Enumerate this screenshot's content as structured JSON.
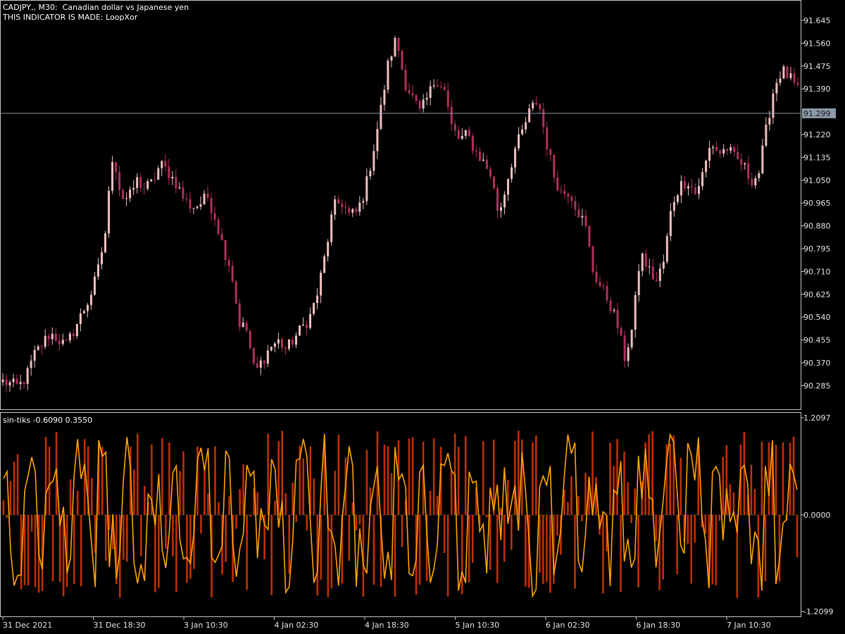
{
  "header": {
    "symbol_line": "CADJPY,, M30:  Canadian dollar vs Japanese yen",
    "indicator_line": "THIS INDICATOR IS MADE: LoopXor"
  },
  "subwindow": {
    "title": "sin-tiks -0.6090 0.3550"
  },
  "colors": {
    "background": "#000000",
    "axis": "#c8c8c8",
    "candle_bull": "#f0c0c0",
    "candle_bear": "#b03060",
    "histogram": "#c03000",
    "osc_line": "#ffa500",
    "price_line": "#8a9aa8",
    "price_tag": "#8a9aa8"
  },
  "chart_data": [
    {
      "type": "candlestick",
      "title": "CADJPY,, M30:  Canadian dollar vs Japanese yen",
      "y_ticks": [
        "91.645",
        "91.560",
        "91.475",
        "91.390",
        "91.220",
        "91.135",
        "91.050",
        "90.965",
        "90.880",
        "90.795",
        "90.710",
        "90.625",
        "90.540",
        "90.455",
        "90.370",
        "90.285"
      ],
      "ylim": [
        90.21,
        91.7
      ],
      "current_price": "91.299",
      "x_ticks": [
        "31 Dec 2021",
        "31 Dec 18:30",
        "3 Jan 10:30",
        "4 Jan 02:30",
        "4 Jan 18:30",
        "5 Jan 10:30",
        "6 Jan 02:30",
        "6 Jan 18:30",
        "7 Jan 10:30"
      ],
      "close_anchors": [
        90.3,
        90.29,
        90.28,
        90.32,
        90.4,
        90.44,
        90.48,
        90.46,
        90.43,
        90.49,
        90.55,
        90.61,
        90.7,
        90.85,
        91.16,
        90.99,
        90.98,
        91.05,
        91.02,
        91.04,
        91.11,
        91.08,
        91.04,
        90.98,
        90.95,
        90.96,
        90.99,
        90.91,
        90.8,
        90.72,
        90.52,
        90.49,
        90.33,
        90.38,
        90.43,
        90.45,
        90.42,
        90.46,
        90.5,
        90.54,
        90.63,
        90.78,
        90.95,
        90.97,
        90.92,
        90.93,
        91.01,
        91.15,
        91.31,
        91.49,
        91.58,
        91.42,
        91.36,
        91.3,
        91.36,
        91.43,
        91.4,
        91.25,
        91.2,
        91.22,
        91.16,
        91.12,
        91.07,
        90.92,
        91.04,
        91.16,
        91.23,
        91.31,
        91.35,
        91.2,
        91.07,
        91.0,
        91.01,
        90.94,
        90.88,
        90.71,
        90.65,
        90.6,
        90.52,
        90.39,
        90.5,
        90.78,
        90.72,
        90.67,
        90.75,
        90.96,
        91.03,
        91.05,
        91.0,
        91.08,
        91.19,
        91.15,
        91.17,
        91.13,
        91.11,
        91.05,
        91.07,
        91.24,
        91.4,
        91.46,
        91.43,
        91.38
      ]
    },
    {
      "type": "histogram+line",
      "title": "sin-tiks -0.6090 0.3550",
      "y_ticks": [
        "1.2097",
        "0.0000",
        "-1.2099"
      ],
      "ylim": [
        -1.2099,
        1.2097
      ],
      "level_lines": [
        0.0
      ],
      "last_values": [
        -0.609,
        0.355
      ],
      "series": [
        {
          "style": "histogram"
        },
        {
          "style": "line"
        }
      ]
    }
  ]
}
